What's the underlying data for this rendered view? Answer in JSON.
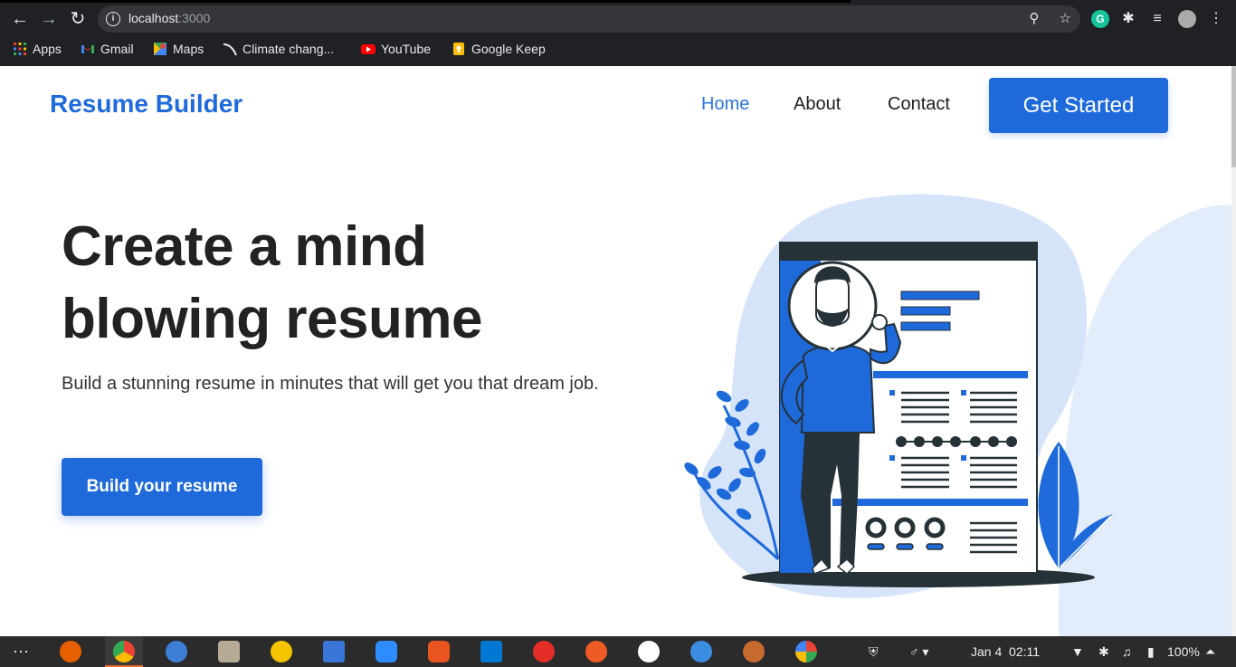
{
  "browser": {
    "url_host": "localhost",
    "url_port": ":3000",
    "bookmarks": [
      {
        "label": "Apps",
        "icon": "apps-grid-icon"
      },
      {
        "label": "Gmail",
        "icon": "gmail-icon"
      },
      {
        "label": "Maps",
        "icon": "maps-icon"
      },
      {
        "label": "Climate chang...",
        "icon": "climate-icon"
      },
      {
        "label": "YouTube",
        "icon": "youtube-icon"
      },
      {
        "label": "Google Keep",
        "icon": "keep-icon"
      }
    ]
  },
  "site": {
    "brand": "Resume Builder",
    "nav": [
      {
        "label": "Home",
        "active": true
      },
      {
        "label": "About",
        "active": false
      },
      {
        "label": "Contact",
        "active": false
      }
    ],
    "cta": "Get Started"
  },
  "hero": {
    "title": "Create a mind blowing resume",
    "subtitle": "Build a stunning resume in minutes that will get you that dream job.",
    "button": "Build your resume"
  },
  "taskbar": {
    "date": "Jan 4",
    "time": "02:11",
    "battery": "100%"
  },
  "colors": {
    "accent": "#1e6adb",
    "blob": "#d6e4fa",
    "dark": "#263238"
  }
}
